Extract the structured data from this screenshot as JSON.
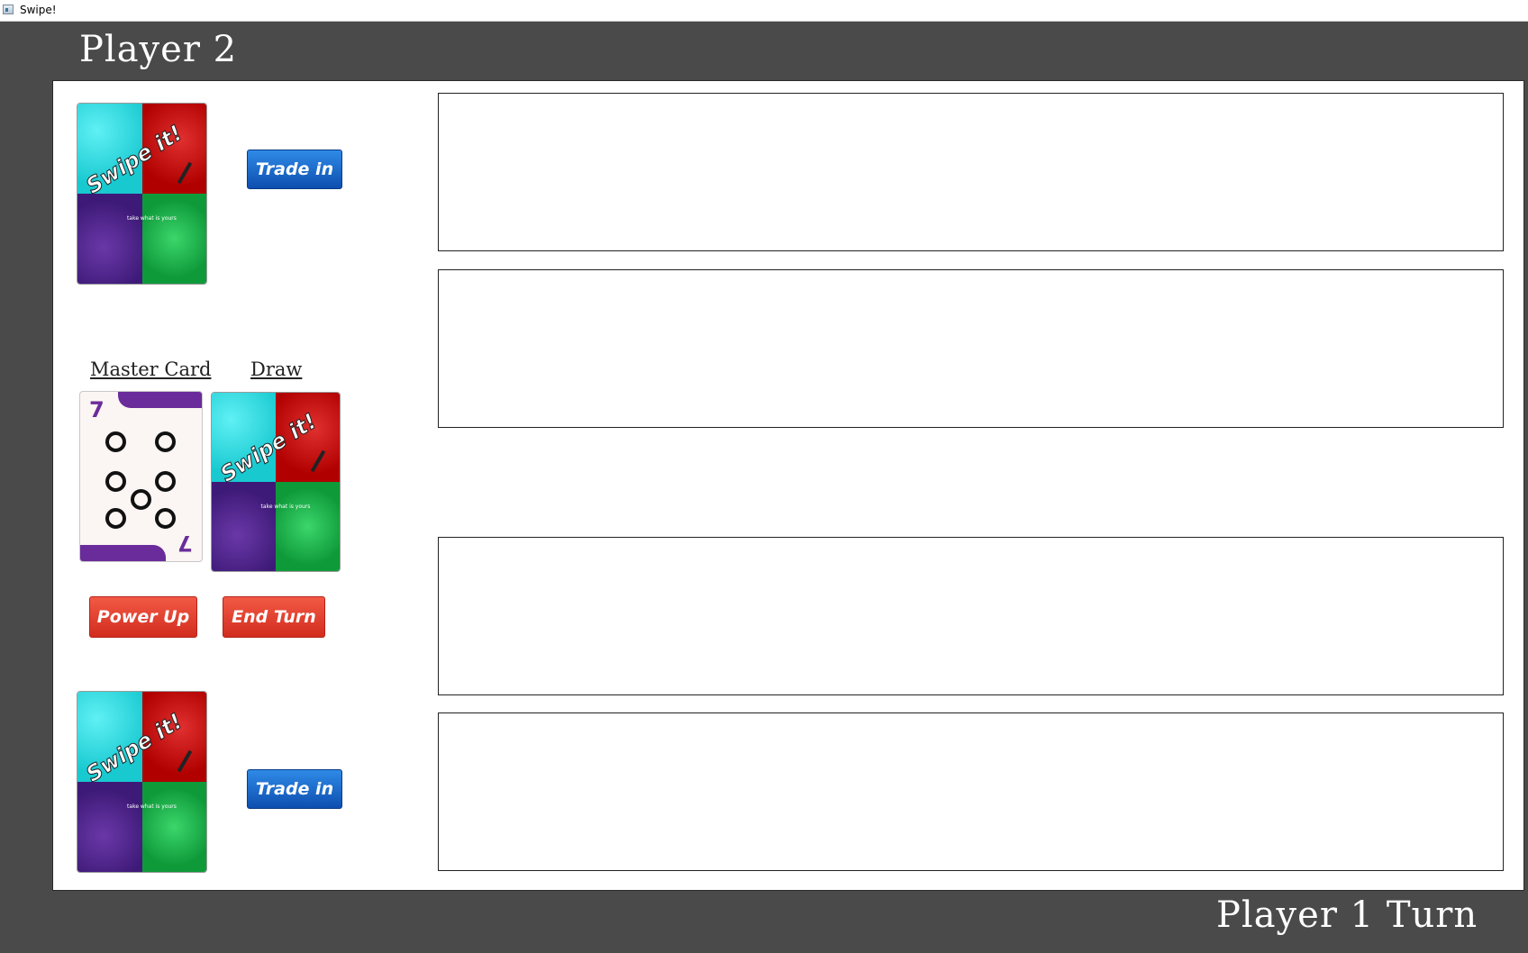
{
  "window": {
    "title": "Swipe!"
  },
  "header": {
    "player_label": "Player 2"
  },
  "footer": {
    "turn_label": "Player 1 Turn"
  },
  "cards": {
    "back_text": "Swipe it!",
    "back_tagline": "take what is yours",
    "master_label": "Master Card",
    "draw_label": "Draw",
    "master_value": "7",
    "master_color": "#6a2c9a"
  },
  "buttons": {
    "trade_in_top": "Trade in",
    "trade_in_bottom": "Trade in",
    "power_up": "Power Up",
    "end_turn": "End Turn"
  },
  "colors": {
    "blue_button": "#0d4fb0",
    "red_button": "#d22c1f",
    "background": "#4a4a4a"
  }
}
